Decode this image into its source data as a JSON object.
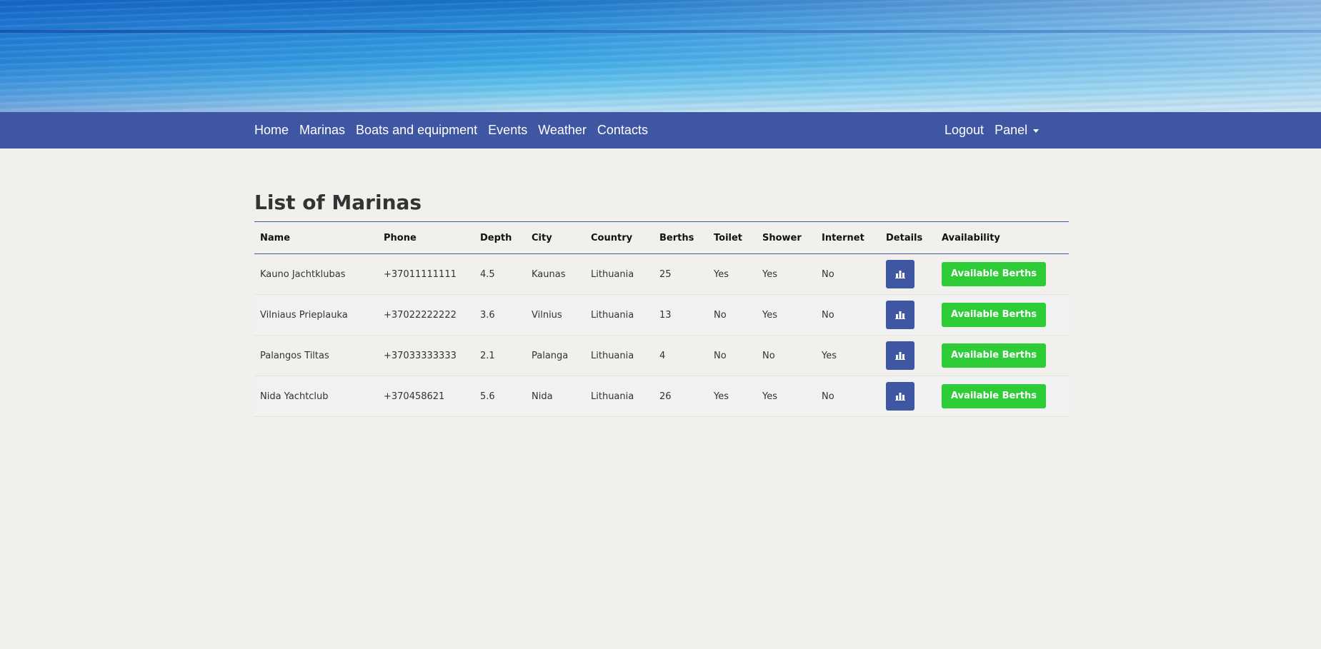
{
  "nav": {
    "left": [
      "Home",
      "Marinas",
      "Boats and equipment",
      "Events",
      "Weather",
      "Contacts"
    ],
    "logout": "Logout",
    "panel": "Panel"
  },
  "page": {
    "title": "List of Marinas"
  },
  "table": {
    "headers": [
      "Name",
      "Phone",
      "Depth",
      "City",
      "Country",
      "Berths",
      "Toilet",
      "Shower",
      "Internet",
      "Details",
      "Availability"
    ],
    "rows": [
      {
        "name": "Kauno Jachtklubas",
        "phone": "+37011111111",
        "depth": "4.5",
        "city": "Kaunas",
        "country": "Lithuania",
        "berths": "25",
        "toilet": "Yes",
        "shower": "Yes",
        "internet": "No",
        "availability": "Available Berths"
      },
      {
        "name": "Vilniaus Prieplauka",
        "phone": "+37022222222",
        "depth": "3.6",
        "city": "Vilnius",
        "country": "Lithuania",
        "berths": "13",
        "toilet": "No",
        "shower": "Yes",
        "internet": "No",
        "availability": "Available Berths"
      },
      {
        "name": "Palangos Tiltas",
        "phone": "+37033333333",
        "depth": "2.1",
        "city": "Palanga",
        "country": "Lithuania",
        "berths": "4",
        "toilet": "No",
        "shower": "No",
        "internet": "Yes",
        "availability": "Available Berths"
      },
      {
        "name": "Nida Yachtclub",
        "phone": "+370458621",
        "depth": "5.6",
        "city": "Nida",
        "country": "Lithuania",
        "berths": "26",
        "toilet": "Yes",
        "shower": "Yes",
        "internet": "No",
        "availability": "Available Berths"
      }
    ]
  },
  "icons": {
    "details": "bar-chart-icon",
    "panel_caret": "caret-down-icon"
  },
  "colors": {
    "navbar": "#3f56a2",
    "details_button": "#3f56a2",
    "available_button": "#2ecc37",
    "background": "#f1f0ec"
  }
}
